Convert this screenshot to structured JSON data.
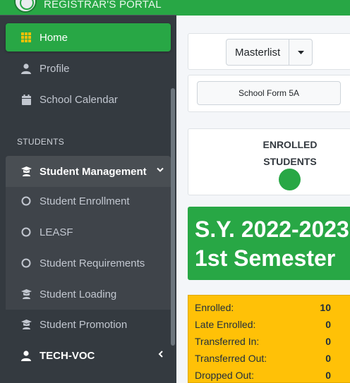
{
  "brand": {
    "title": "REGISTRAR'S PORTAL"
  },
  "sidebar": {
    "items": [
      {
        "label": "Home",
        "icon": "grid-icon"
      },
      {
        "label": "Profile",
        "icon": "user-icon"
      },
      {
        "label": "School Calendar",
        "icon": "calendar-icon"
      }
    ],
    "section_header": "STUDENTS",
    "student_management": {
      "label": "Student Management",
      "icon": "graduate-icon",
      "children": [
        {
          "label": "Student Enrollment",
          "icon": "circle-icon"
        },
        {
          "label": "LEASF",
          "icon": "circle-icon"
        },
        {
          "label": "Student Requirements",
          "icon": "circle-icon"
        },
        {
          "label": "Student Loading",
          "icon": "graduate-icon"
        }
      ]
    },
    "student_promotion": {
      "label": "Student Promotion",
      "icon": "graduate-icon"
    },
    "tech_voc": {
      "label": "TECH-VOC",
      "icon": "user-icon"
    }
  },
  "content": {
    "masterlist_button": "Masterlist",
    "school_form_button": "School Form 5A",
    "enrolled_card": {
      "line1": "ENROLLED",
      "line2": "STUDENTS"
    },
    "school_year": {
      "line1": "S.Y. 2022-2023",
      "line2": "1st Semester"
    },
    "stats": [
      {
        "label": "Enrolled:",
        "value": "10"
      },
      {
        "label": "Late Enrolled:",
        "value": "0"
      },
      {
        "label": "Transferred In:",
        "value": "0"
      },
      {
        "label": "Transferred Out:",
        "value": "0"
      },
      {
        "label": "Dropped Out:",
        "value": "0"
      }
    ]
  },
  "colors": {
    "primary": "#28a745",
    "sidebar": "#343a40",
    "warning": "#ffc107"
  }
}
